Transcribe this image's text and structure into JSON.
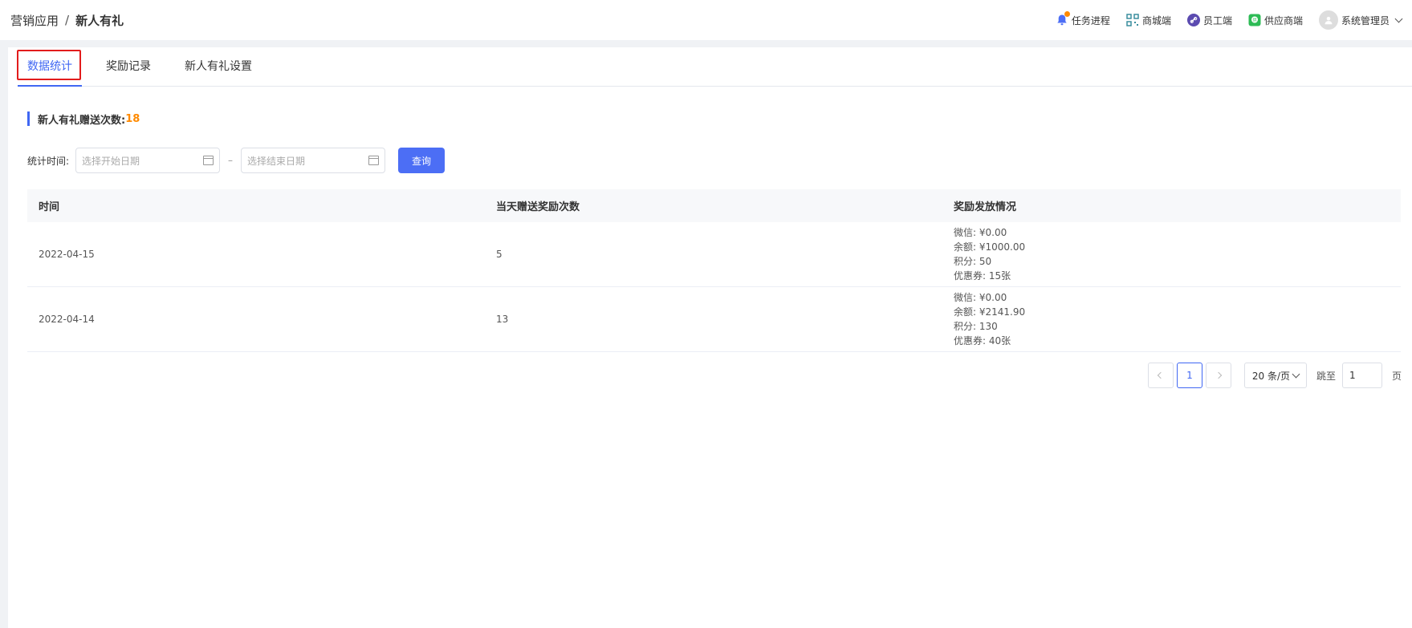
{
  "header": {
    "breadcrumb_parent": "营销应用",
    "breadcrumb_sep": "/",
    "breadcrumb_current": "新人有礼",
    "task_progress": "任务进程",
    "mall": "商城端",
    "staff": "员工端",
    "supplier": "供应商端",
    "user": "系统管理员"
  },
  "tabs": [
    {
      "label": "数据统计",
      "active": true
    },
    {
      "label": "奖励记录",
      "active": false
    },
    {
      "label": "新人有礼设置",
      "active": false
    }
  ],
  "stats": {
    "label": "新人有礼赠送次数:",
    "value": "18"
  },
  "filter": {
    "label": "统计时间:",
    "start_placeholder": "选择开始日期",
    "end_placeholder": "选择结束日期",
    "separator": "–",
    "query_button": "查询"
  },
  "table": {
    "headers": [
      "时间",
      "当天赠送奖励次数",
      "奖励发放情况"
    ],
    "rows": [
      {
        "date": "2022-04-15",
        "count": "5",
        "rewards": [
          "微信: ¥0.00",
          "余额: ¥1000.00",
          "积分: 50",
          "优惠券: 15张"
        ]
      },
      {
        "date": "2022-04-14",
        "count": "13",
        "rewards": [
          "微信: ¥0.00",
          "余额: ¥2141.90",
          "积分: 130",
          "优惠券: 40张"
        ]
      }
    ]
  },
  "pagination": {
    "current_page": "1",
    "page_size": "20 条/页",
    "jump_label": "跳至",
    "jump_value": "1",
    "page_suffix": "页"
  },
  "colors": {
    "primary": "#4067f3",
    "accent": "#ff8a00",
    "highlight_border": "#e21c1c"
  }
}
